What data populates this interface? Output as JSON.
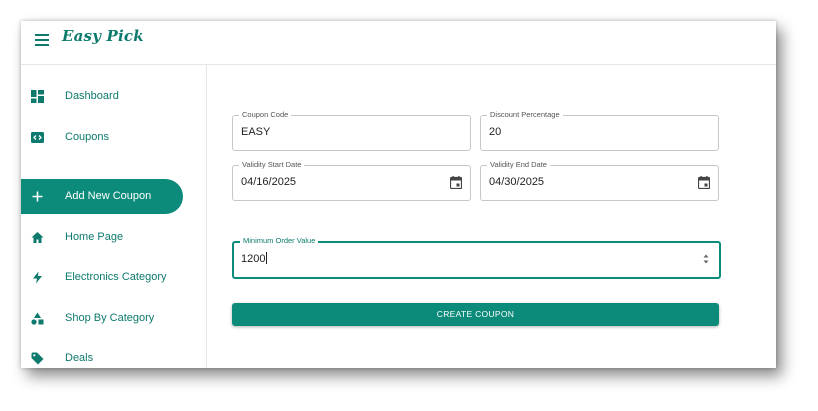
{
  "app": {
    "brand": "Easy Pick"
  },
  "sidebar": {
    "items": [
      {
        "label": "Dashboard",
        "icon": "dashboard-icon",
        "active": false
      },
      {
        "label": "Coupons",
        "icon": "coupon-icon",
        "active": false
      },
      {
        "label": "Add New Coupon",
        "icon": "plus-icon",
        "active": true
      },
      {
        "label": "Home Page",
        "icon": "home-icon",
        "active": false
      },
      {
        "label": "Electronics Category",
        "icon": "lightning-icon",
        "active": false
      },
      {
        "label": "Shop By Category",
        "icon": "category-shapes-icon",
        "active": false
      },
      {
        "label": "Deals",
        "icon": "tag-icon",
        "active": false
      }
    ]
  },
  "form": {
    "coupon_code": {
      "label": "Coupon Code",
      "value": "EASY"
    },
    "discount_percentage": {
      "label": "Discount Percentage",
      "value": "20"
    },
    "validity_start": {
      "label": "Validity Start Date",
      "value": "04/16/2025"
    },
    "validity_end": {
      "label": "Validity End Date",
      "value": "04/30/2025"
    },
    "min_order": {
      "label": "Minimum Order Value",
      "value": "1200"
    },
    "submit_label": "CREATE COUPON"
  },
  "colors": {
    "primary": "#0d8b7a",
    "primary_text": "#0d7a6d"
  }
}
